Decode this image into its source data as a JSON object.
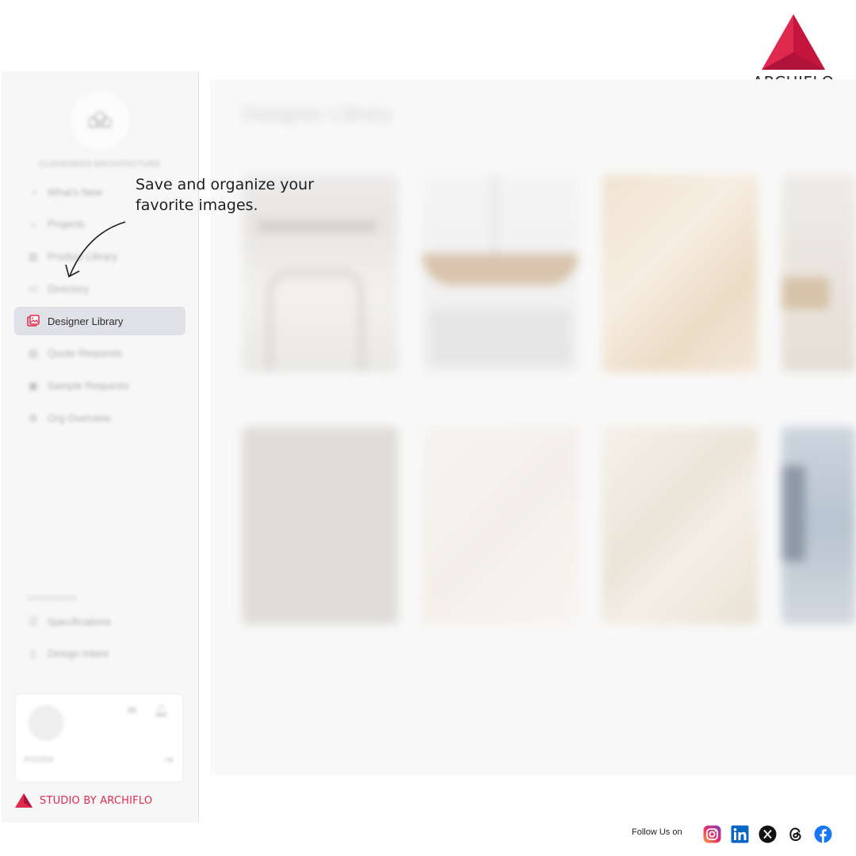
{
  "brand": {
    "name": "ARCHIFLO",
    "accent": "#e0294f"
  },
  "sidebar": {
    "org_name": "CLOUDSEED ARCHITECTURE",
    "items": [
      {
        "label": "What's New",
        "icon": "megaphone-icon"
      },
      {
        "label": "Projects",
        "icon": "home-icon"
      },
      {
        "label": "Product Library",
        "icon": "library-icon"
      },
      {
        "label": "Directory",
        "icon": "contact-card-icon"
      },
      {
        "label": "Designer Library",
        "icon": "image-gallery-icon",
        "active": true
      },
      {
        "label": "Quote Requests",
        "icon": "quote-icon"
      },
      {
        "label": "Sample Requests",
        "icon": "sample-icon"
      },
      {
        "label": "Org Overview",
        "icon": "gear-icon"
      }
    ],
    "standards_label": "STANDARDS",
    "standards_items": [
      {
        "label": "Specifications",
        "icon": "checklist-icon"
      },
      {
        "label": "Design Intent",
        "icon": "document-icon"
      }
    ],
    "user": {
      "name": "Anusha"
    },
    "studio_label": "STUDIO BY ARCHIFLO"
  },
  "main": {
    "title": "Designer Library",
    "tiles": [
      {
        "kind": "mirror-bath"
      },
      {
        "kind": "pendant-light"
      },
      {
        "kind": "beige-marble"
      },
      {
        "kind": "wall-sconce"
      },
      {
        "kind": "grey-stone"
      },
      {
        "kind": "white-marble"
      },
      {
        "kind": "veined-marble"
      },
      {
        "kind": "blue-interior"
      }
    ]
  },
  "callout": {
    "text_line1": "Save and organize your",
    "text_line2": "favorite images."
  },
  "footer": {
    "follow_label": "Follow Us on",
    "socials": [
      "instagram-icon",
      "linkedin-icon",
      "x-icon",
      "threads-icon",
      "facebook-icon"
    ]
  }
}
